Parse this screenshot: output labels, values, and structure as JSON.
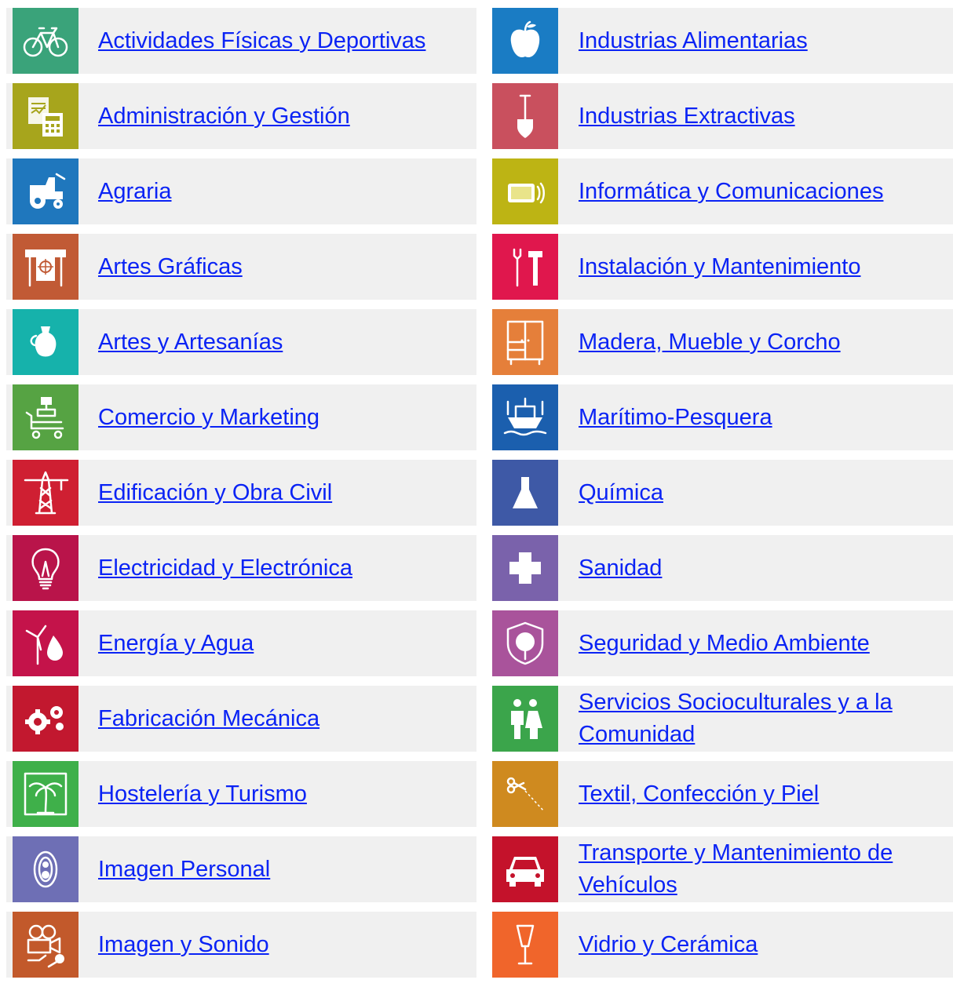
{
  "left": [
    {
      "label": "Actividades Físicas y Deportivas",
      "color": "#3aa37a",
      "icon": "bicycle-icon"
    },
    {
      "label": "Administración y Gestión",
      "color": "#a7a51c",
      "icon": "document-calculator-icon"
    },
    {
      "label": "Agraria",
      "color": "#1f77bd",
      "icon": "tractor-icon"
    },
    {
      "label": "Artes Gráficas",
      "color": "#c15a35",
      "icon": "plotter-icon"
    },
    {
      "label": "Artes y Artesanías",
      "color": "#16b2ab",
      "icon": "vase-icon"
    },
    {
      "label": "Comercio y Marketing",
      "color": "#56a343",
      "icon": "cart-icon"
    },
    {
      "label": "Edificación y Obra Civil",
      "color": "#cf1f32",
      "icon": "crane-icon"
    },
    {
      "label": "Electricidad y Electrónica",
      "color": "#b9144a",
      "icon": "lightbulb-icon"
    },
    {
      "label": "Energía y Agua",
      "color": "#c4134a",
      "icon": "wind-water-icon"
    },
    {
      "label": "Fabricación Mecánica",
      "color": "#c2182f",
      "icon": "gears-icon"
    },
    {
      "label": "Hostelería y Turismo",
      "color": "#3fb04a",
      "icon": "palm-tree-icon"
    },
    {
      "label": "Imagen Personal",
      "color": "#6e6fb5",
      "icon": "mirror-icon"
    },
    {
      "label": "Imagen y Sonido",
      "color": "#c2592b",
      "icon": "camera-microphone-icon"
    }
  ],
  "right": [
    {
      "label": "Industrias Alimentarias",
      "color": "#1a7cc4",
      "icon": "apple-icon"
    },
    {
      "label": "Industrias Extractivas",
      "color": "#c9505e",
      "icon": "shovel-icon"
    },
    {
      "label": "Informática y Comunicaciones",
      "color": "#bdb414",
      "icon": "tablet-wireless-icon"
    },
    {
      "label": "Instalación y Mantenimiento",
      "color": "#e0174d",
      "icon": "tools-icon"
    },
    {
      "label": "Madera, Mueble y Corcho",
      "color": "#e57f3a",
      "icon": "wardrobe-icon"
    },
    {
      "label": "Marítimo-Pesquera",
      "color": "#1b5fae",
      "icon": "boat-icon"
    },
    {
      "label": "Química",
      "color": "#3e59a6",
      "icon": "flask-icon"
    },
    {
      "label": "Sanidad",
      "color": "#7a62ab",
      "icon": "medical-cross-icon"
    },
    {
      "label": "Seguridad y Medio Ambiente",
      "color": "#a9539b",
      "icon": "shield-tree-icon"
    },
    {
      "label": "Servicios Socioculturales y a la Comunidad",
      "color": "#3ba54b",
      "icon": "people-icon"
    },
    {
      "label": "Textil, Confección y Piel",
      "color": "#cf8a1f",
      "icon": "scissors-icon"
    },
    {
      "label": "Transporte y Mantenimiento de Vehículos",
      "color": "#c4122b",
      "icon": "car-icon"
    },
    {
      "label": "Vidrio y Cerámica",
      "color": "#f0652b",
      "icon": "glass-icon"
    }
  ]
}
